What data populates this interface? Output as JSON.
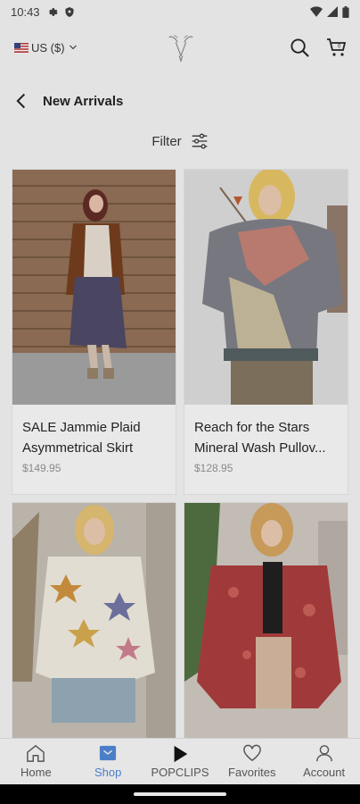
{
  "status_bar": {
    "time": "10:43",
    "icons": [
      "settings-icon",
      "shield-icon",
      "wifi-icon",
      "signal-icon",
      "battery-icon"
    ]
  },
  "header": {
    "currency": "US ($)",
    "logo_icon": "brand-logo",
    "icons": [
      "search-icon",
      "cart-icon"
    ]
  },
  "page": {
    "title": "New Arrivals",
    "filter_label": "Filter"
  },
  "products": [
    {
      "name": "SALE Jammie Plaid Asymmetrical Skirt",
      "price": "$149.95"
    },
    {
      "name": "Reach for the Stars Mineral Wash Pullov...",
      "price": "$128.95"
    },
    {
      "name": "",
      "price": ""
    },
    {
      "name": "",
      "price": ""
    }
  ],
  "bottom_nav": {
    "items": [
      {
        "label": "Home",
        "icon": "home-icon"
      },
      {
        "label": "Shop",
        "icon": "shop-icon",
        "active": true
      },
      {
        "label": "POPCLIPS",
        "icon": "play-icon"
      },
      {
        "label": "Favorites",
        "icon": "heart-icon"
      },
      {
        "label": "Account",
        "icon": "user-icon"
      }
    ]
  },
  "colors": {
    "background": "#e3e3e3",
    "accent": "#4a7fc8",
    "text": "#202020",
    "price": "#8a8a8a"
  }
}
